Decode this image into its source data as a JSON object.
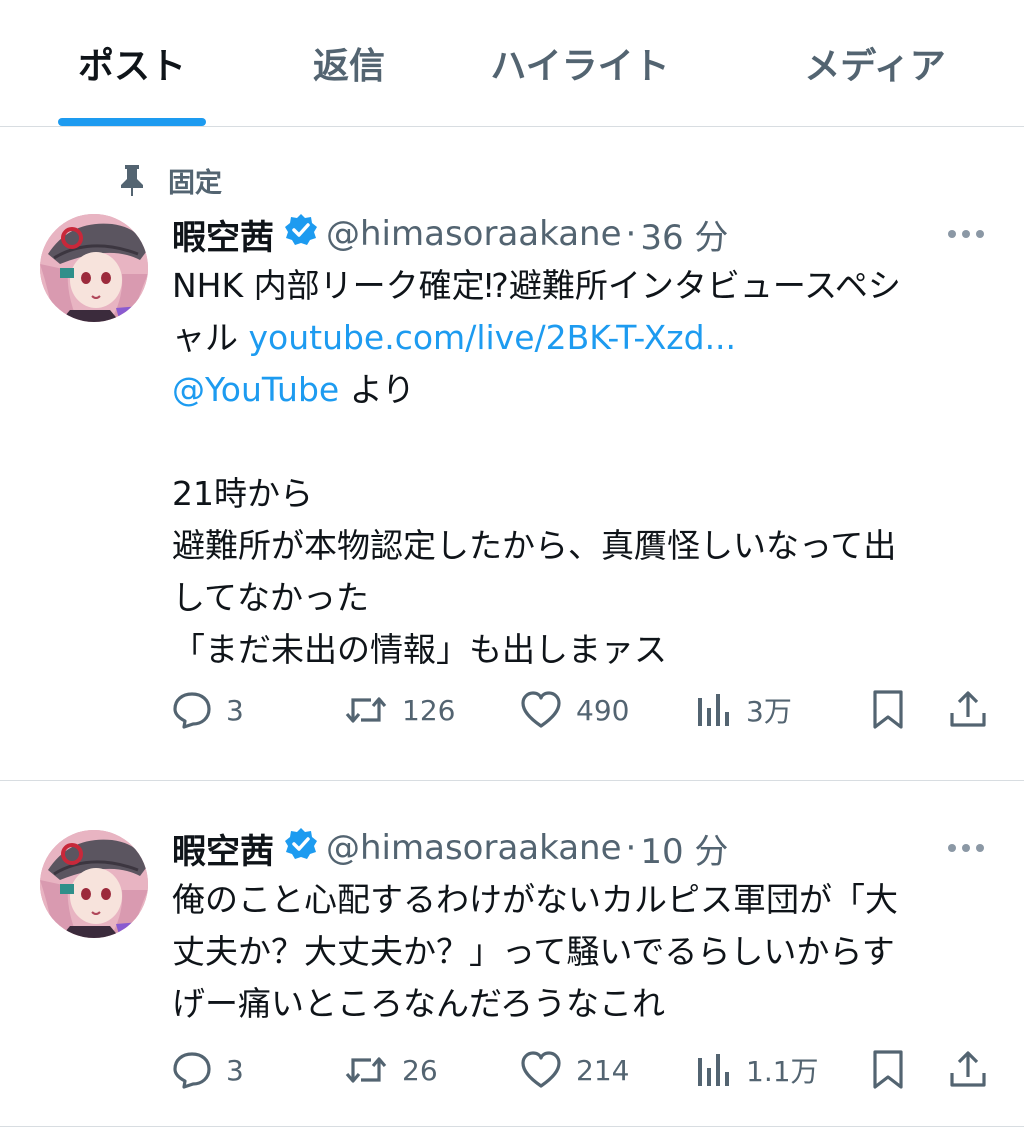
{
  "tabs": [
    {
      "label": "ポスト",
      "active": true
    },
    {
      "label": "返信",
      "active": false
    },
    {
      "label": "ハイライト",
      "active": false
    },
    {
      "label": "メディア",
      "active": false
    }
  ],
  "colors": {
    "accent": "#1d9bf0",
    "text": "#0f1419",
    "secondary": "#536471",
    "divider": "#d8dde1"
  },
  "posts": [
    {
      "pinned_label": "固定",
      "display_name": "暇空茜",
      "handle": "@himasoraakane",
      "separator": "·",
      "time": "36 分",
      "text": {
        "line1": "NHK 内部リーク確定⁉︎避難所インタビュースペシ",
        "line2_prefix": "ャル",
        "link": "youtube.com/live/2BK-T-Xzd...",
        "mention": "@YouTube",
        "line3_suffix": "より",
        "line5": "21時から",
        "line6": "避難所が本物認定したから、真贋怪しいなって出",
        "line7": "してなかった",
        "line8": "「まだ未出の情報」も出しまァス"
      },
      "stats": {
        "replies": "3",
        "reposts": "126",
        "likes": "490",
        "views": "3万"
      }
    },
    {
      "display_name": "暇空茜",
      "handle": "@himasoraakane",
      "separator": "·",
      "time": "10 分",
      "text": {
        "line1": "俺のこと心配するわけがないカルピス軍団が「大",
        "line2": "丈夫か？大丈夫か？」って騒いでるらしいからす",
        "line3": "げー痛いところなんだろうなこれ"
      },
      "stats": {
        "replies": "3",
        "reposts": "26",
        "likes": "214",
        "views": "1.1万"
      }
    }
  ],
  "icons": {
    "pin": "pin-icon",
    "verified": "verified-badge-icon",
    "more": "more-dots-icon",
    "reply": "reply-bubble-icon",
    "repost": "repost-arrows-icon",
    "like": "heart-icon",
    "views": "bar-chart-icon",
    "bookmark": "bookmark-icon",
    "share": "share-upload-icon"
  }
}
